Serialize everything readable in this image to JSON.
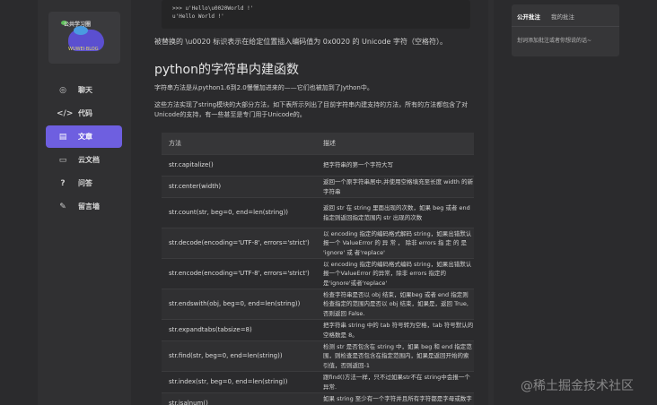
{
  "sidebar": {
    "logo": {
      "title": "公共学习圈",
      "subtitle": "WUWEI·BLOG"
    },
    "items": [
      {
        "label": "聊天",
        "icon": "chat-icon",
        "glyph": "◎"
      },
      {
        "label": "代码",
        "icon": "code-icon",
        "glyph": "</>"
      },
      {
        "label": "文章",
        "icon": "article-icon",
        "glyph": "▤",
        "active": true
      },
      {
        "label": "云文档",
        "icon": "folder-icon",
        "glyph": "▭"
      },
      {
        "label": "问答",
        "icon": "question-icon",
        "glyph": "?"
      },
      {
        "label": "留言墙",
        "icon": "edit-icon",
        "glyph": "✎"
      }
    ]
  },
  "main": {
    "code_lines": [
      ">>> u'Hello\\u0020World !'",
      "u'Hello World !'"
    ],
    "p1": "被替换的 \\u0020 标识表示在给定位置插入编码值为 0x0020 的 Unicode 字符（空格符）。",
    "heading": "python的字符串内建函数",
    "p2": "字符串方法是从python1.6到2.0慢慢加进来的——它们也被加到了Jython中。",
    "p3": "这些方法实现了string模块的大部分方法，如下表所示列出了目前字符串内建支持的方法，所有的方法都包含了对Unicode的支持，有一些甚至是专门用于Unicode的。",
    "table": {
      "headers": [
        "方法",
        "描述"
      ],
      "rows": [
        [
          "str.capitalize()",
          "把字符串的第一个字符大写"
        ],
        [
          "str.center(width)",
          "返回一个原字符串居中,并使用空格填充至长度 width 的新字符串"
        ],
        [
          "str.count(str, beg=0, end=len(string))",
          "返回 str 在 string 里面出现的次数，如果 beg 或者 end 指定则返回指定范围内 str 出现的次数"
        ],
        [
          "str.decode(encoding='UTF-8', errors='strict')",
          "以 encoding 指定的编码格式解码 string，如果出错默认报一个 ValueError 的 异 常 ， 除非 errors 指 定 的 是 'ignore' 或 者'replace'"
        ],
        [
          "str.encode(encoding='UTF-8', errors='strict')",
          "以 encoding 指定的编码格式编码 string，如果出错默认报一个ValueError 的异常，除非 errors 指定的是'ignore'或者'replace'"
        ],
        [
          "str.endswith(obj, beg=0, end=len(string))",
          "检查字符串是否以 obj 结束，如果beg 或者 end 指定则检查指定的范围内是否以 obj 结束，如果是，返回 True,否则返回 False."
        ],
        [
          "str.expandtabs(tabsize=8)",
          "把字符串 string 中的 tab 符号转为空格，tab 符号默认的空格数是 8。"
        ],
        [
          "str.find(str, beg=0, end=len(string))",
          "检测 str 是否包含在 string 中，如果 beg 和 end 指定范围，则检查是否包含在指定范围内，如果是返回开始的索引值，否则返回-1"
        ],
        [
          "str.index(str, beg=0, end=len(string))",
          "跟find()方法一样，只不过如果str不在 string中会报一个异常."
        ],
        [
          "str.isalnum()",
          "如果 string 至少有一个字符并且所有字符都是字母或数字则返回 True，否则返回 False"
        ]
      ]
    }
  },
  "right_panel": {
    "tabs": [
      "公开批注",
      "我的批注"
    ],
    "message": "划词添加批注或者你想说的话~"
  },
  "watermark": "@稀土掘金技术社区"
}
